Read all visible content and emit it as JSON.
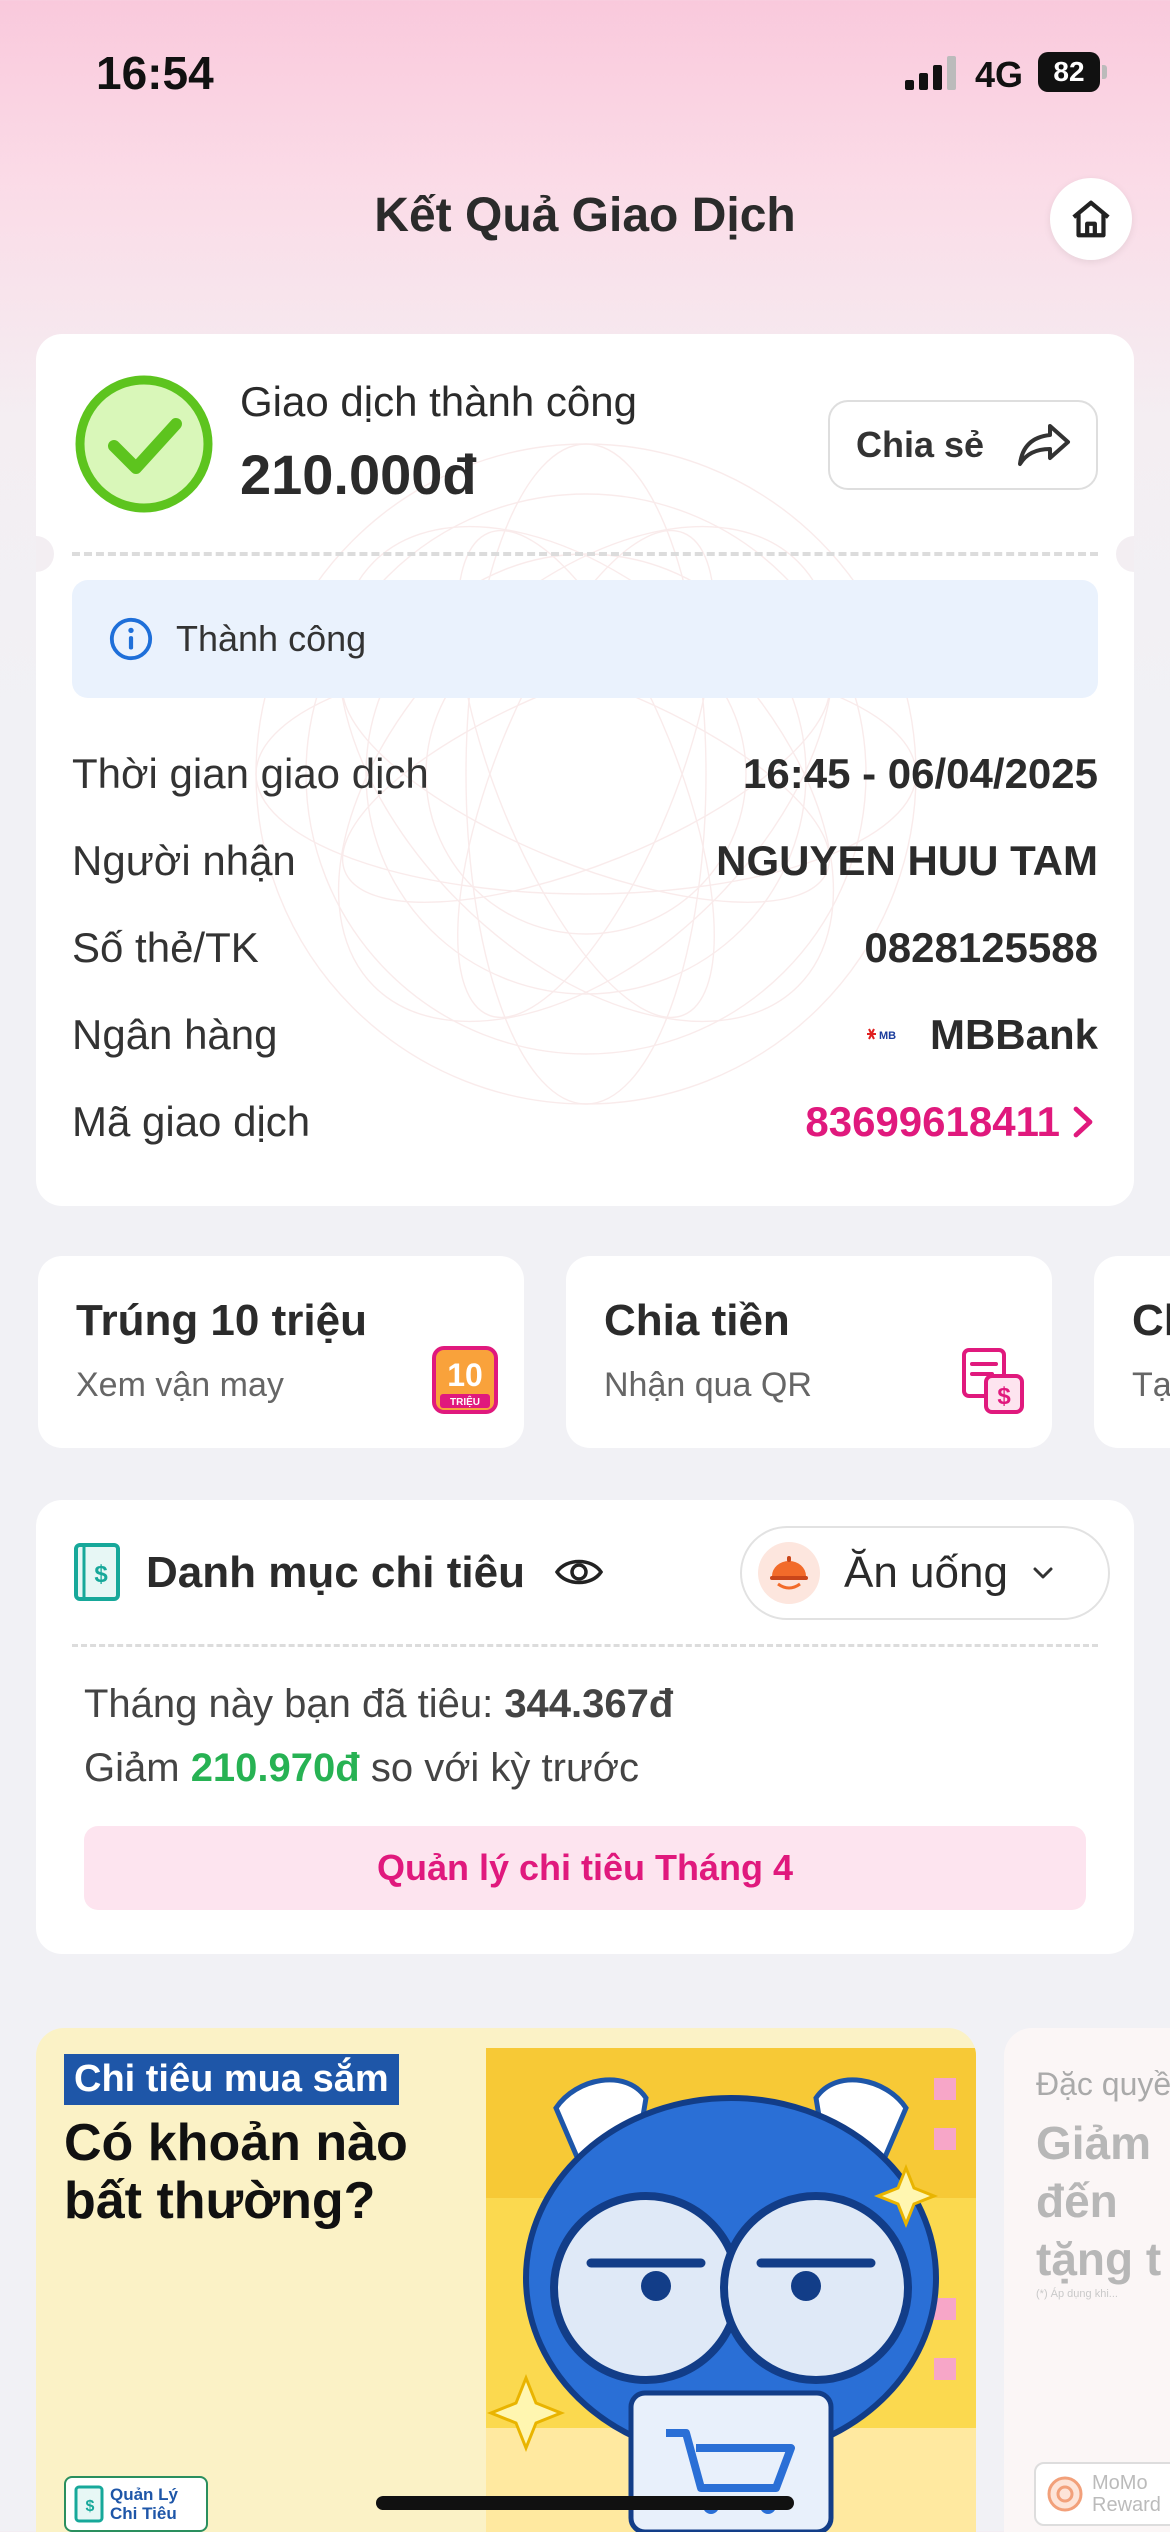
{
  "status_bar": {
    "time": "16:54",
    "network": "4G",
    "battery": "82"
  },
  "header": {
    "title": "Kết Quả Giao Dịch"
  },
  "result": {
    "status": "Giao dịch thành công",
    "amount": "210.000đ",
    "share_label": "Chia sẻ",
    "info_label": "Thành công",
    "rows": [
      {
        "label": "Thời gian giao dịch",
        "value": "16:45 - 06/04/2025"
      },
      {
        "label": "Người nhận",
        "value": "NGUYEN HUU TAM"
      },
      {
        "label": "Số thẻ/TK",
        "value": "0828125588"
      },
      {
        "label": "Ngân hàng",
        "value": "MBBank",
        "logo_text": "MB"
      },
      {
        "label": "Mã giao dịch",
        "value": "83699618411"
      }
    ]
  },
  "tiles": [
    {
      "title": "Trúng 10 triệu",
      "subtitle": "Xem vận may",
      "icon_text": "10",
      "icon_sub": "TRIỆU"
    },
    {
      "title": "Chia tiền",
      "subtitle": "Nhận qua QR"
    },
    {
      "title": "Ch",
      "subtitle": "Tạ"
    }
  ],
  "spending": {
    "title": "Danh mục chi tiêu",
    "category": "Ăn uống",
    "line1_prefix": "Tháng này bạn đã tiêu: ",
    "line1_amount": "344.367đ",
    "line2_prefix": "Giảm ",
    "line2_amount": "210.970đ",
    "line2_suffix": " so với kỳ trước",
    "button": "Quản lý chi tiêu Tháng 4"
  },
  "banners": {
    "main": {
      "tag": "Chi tiêu mua sắm",
      "headline_1": "Có khoản nào",
      "headline_2": "bất thường?",
      "logo_line_1": "Quản Lý",
      "logo_line_2": "Chi Tiêu"
    },
    "side": {
      "lead": "Đặc quyề",
      "head_1": "Giảm",
      "head_2": "đến",
      "head_3": "tặng t",
      "fine_print": "(*) Áp dụng khi...",
      "reward_1": "MoMo",
      "reward_2": "Reward"
    }
  },
  "colors": {
    "accent": "#e0197d",
    "success": "#5dc41e",
    "positive": "#27b253",
    "info": "#1e6fd9"
  }
}
